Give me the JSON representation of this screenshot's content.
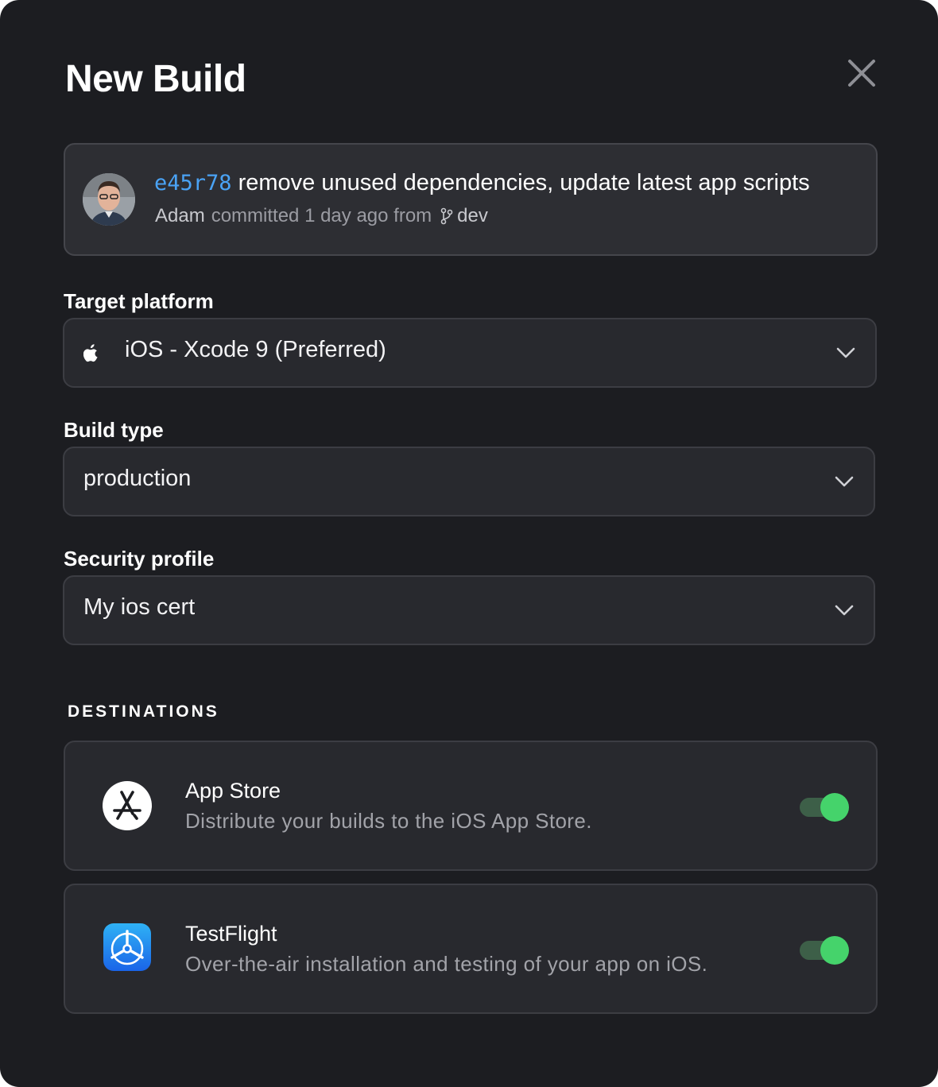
{
  "modal": {
    "title": "New Build"
  },
  "commit": {
    "hash": "e45r78",
    "message": "remove unused dependencies, update latest app scripts",
    "author": "Adam",
    "meta": "committed 1 day ago from",
    "branch": "dev"
  },
  "form": {
    "target_platform": {
      "label": "Target platform",
      "value": "iOS - Xcode 9 (Preferred)",
      "icon": "apple-icon"
    },
    "build_type": {
      "label": "Build type",
      "value": "production"
    },
    "security_profile": {
      "label": "Security profile",
      "value": "My ios cert"
    }
  },
  "destinations": {
    "heading": "DESTINATIONS",
    "items": [
      {
        "name": "App Store",
        "description": "Distribute your builds to the iOS App Store.",
        "icon": "app-store-icon",
        "enabled": true
      },
      {
        "name": "TestFlight",
        "description": "Over-the-air installation and testing of your app on iOS.",
        "icon": "testflight-icon",
        "enabled": true
      }
    ]
  },
  "colors": {
    "background": "#1c1d21",
    "card": "#28292e",
    "hash": "#4aa3f5",
    "toggle_on": "#45d36b"
  }
}
